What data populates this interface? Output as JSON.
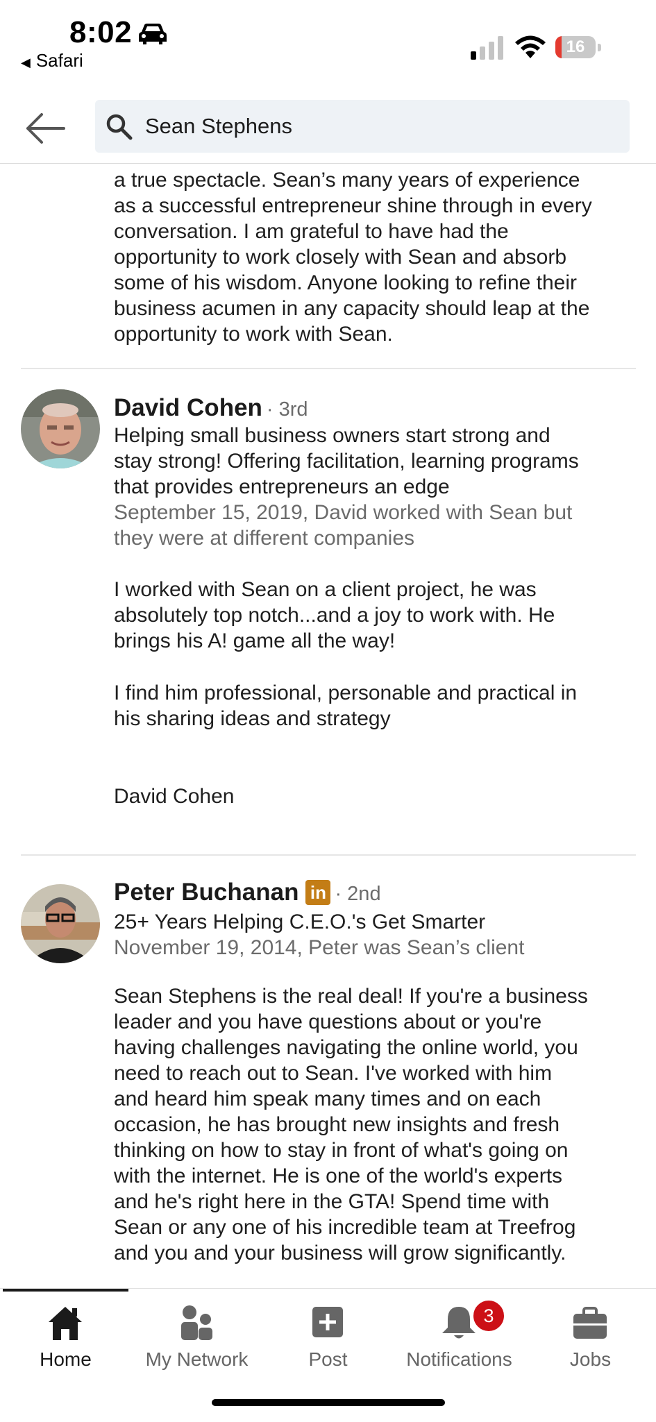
{
  "status_bar": {
    "time": "8:02",
    "back_app": "Safari",
    "battery": "16",
    "battery_level": 0.16
  },
  "search": {
    "query": "Sean Stephens"
  },
  "recommendations": [
    {
      "body_lines": [
        "a true spectacle. Sean’s many years of experience",
        "as a successful entrepreneur shine through in every",
        "conversation. I am grateful to have had the",
        "opportunity to work closely with Sean and absorb",
        "some of his wisdom. Anyone looking to refine their",
        "business acumen in any capacity should leap at the",
        "opportunity to work with Sean."
      ]
    },
    {
      "name": "David Cohen",
      "degree": "· 3rd",
      "headline_lines": [
        "Helping small business owners start strong and",
        "stay strong! Offering facilitation, learning programs",
        "that provides entrepreneurs an edge"
      ],
      "meta_lines": [
        "September 15, 2019, David worked with Sean but",
        "they were at different companies"
      ],
      "body_p1_lines": [
        "I worked with Sean on a client project, he was",
        "absolutely top notch...and a joy to work with. He",
        "brings his A! game all the way!"
      ],
      "body_p2_lines": [
        "I find him professional, personable and practical in",
        "his sharing ideas and strategy"
      ],
      "signoff": "David Cohen"
    },
    {
      "name": "Peter Buchanan",
      "badge": "in",
      "degree": "· 2nd",
      "headline": "25+ Years Helping C.E.O.'s Get Smarter",
      "meta": "November 19, 2014, Peter was Sean’s client",
      "body_lines": [
        "Sean Stephens is the real deal! If you're a business",
        "leader and you have questions about or you're",
        "having challenges navigating the online world, you",
        "need to reach out to Sean. I've worked with him",
        "and heard him speak many times and on each",
        "occasion, he has brought new insights and fresh",
        "thinking on how to stay in front of what's going on",
        "with the internet. He is one of the world's experts",
        "and he's right here in the GTA! Spend time with",
        "Sean or any one of his incredible team at Treefrog",
        "and you and your business will grow significantly."
      ]
    }
  ],
  "bottom_nav": {
    "items": [
      {
        "label": "Home",
        "icon": "home-icon",
        "active": true
      },
      {
        "label": "My Network",
        "icon": "people-icon"
      },
      {
        "label": "Post",
        "icon": "plus-square-icon"
      },
      {
        "label": "Notifications",
        "icon": "bell-icon",
        "badge": "3"
      },
      {
        "label": "Jobs",
        "icon": "briefcase-icon"
      }
    ]
  },
  "colors": {
    "linkedin_badge": "#c37d16",
    "notification_badge": "#cc1016",
    "search_bg": "#eef2f6"
  }
}
